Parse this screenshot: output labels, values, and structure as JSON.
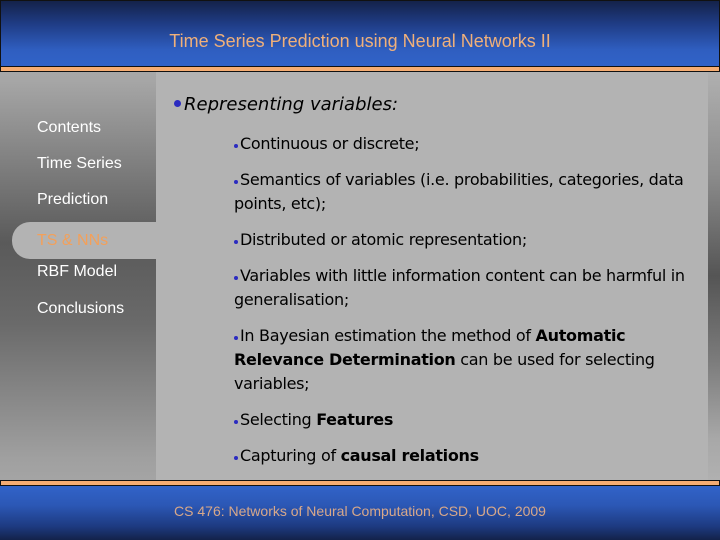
{
  "header": {
    "title": "Time Series Prediction using Neural Networks II"
  },
  "sidebar": {
    "items": [
      {
        "label": "Contents",
        "active": false
      },
      {
        "label": "Time Series",
        "active": false
      },
      {
        "label": "Prediction",
        "active": false
      },
      {
        "label": "TS & NNs",
        "active": true
      },
      {
        "label": "RBF Model",
        "active": false
      },
      {
        "label": "Conclusions",
        "active": false
      }
    ]
  },
  "content": {
    "heading": "Representing variables:",
    "bullets": [
      {
        "parts": [
          {
            "text": "Continuous or discrete;",
            "bold": false
          }
        ]
      },
      {
        "parts": [
          {
            "text": "Semantics of variables (i.e. probabilities, categories, data points, etc);",
            "bold": false
          }
        ]
      },
      {
        "parts": [
          {
            "text": "Distributed or atomic representation;",
            "bold": false
          }
        ]
      },
      {
        "parts": [
          {
            "text": "Variables with little information content can be harmful in generalisation;",
            "bold": false
          }
        ]
      },
      {
        "parts": [
          {
            "text": "In Bayesian estimation the method of ",
            "bold": false
          },
          {
            "text": "Automatic Relevance Determination",
            "bold": true
          },
          {
            "text": " can be used for selecting variables;",
            "bold": false
          }
        ]
      },
      {
        "parts": [
          {
            "text": "Selecting ",
            "bold": false
          },
          {
            "text": "Features",
            "bold": true
          }
        ]
      },
      {
        "parts": [
          {
            "text": "Capturing of ",
            "bold": false
          },
          {
            "text": "causal relations",
            "bold": true
          }
        ]
      }
    ]
  },
  "footer": {
    "text": "CS 476: Networks of Neural Computation, CSD, UOC, 2009"
  },
  "colors": {
    "header_blue": "#3163c8",
    "accent_orange": "#f6ad72",
    "title_text": "#f0b07a",
    "active_nav_text": "#f3a05a",
    "bullet": "#2b2bc0",
    "panel_gray": "#b3b3b3"
  }
}
